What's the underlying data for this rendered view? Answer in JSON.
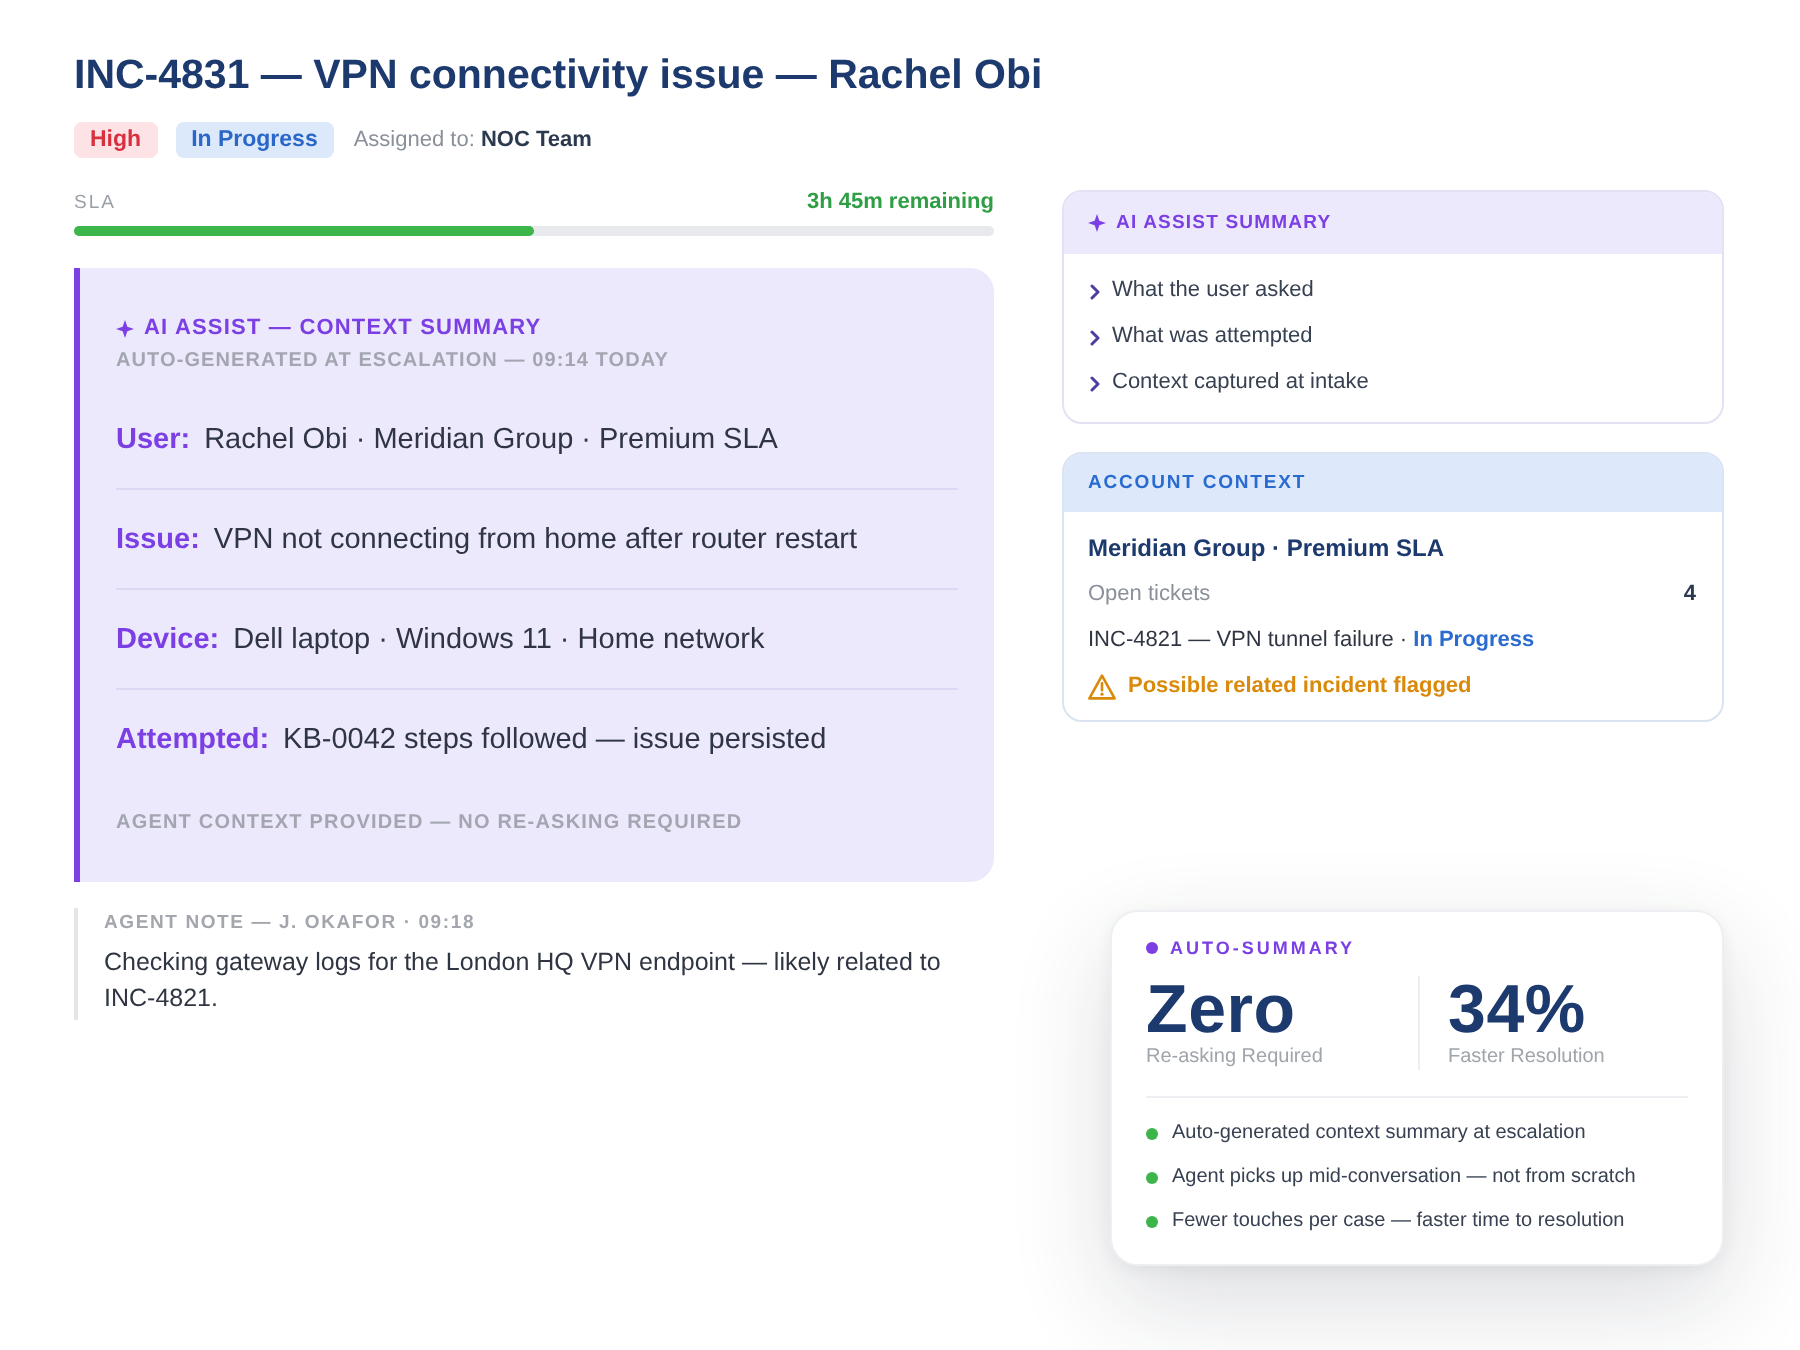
{
  "ticket": {
    "title": "INC-4831 — VPN connectivity issue — Rachel Obi",
    "badges": [
      {
        "kind": "priority",
        "text": "High"
      },
      {
        "kind": "status",
        "text": "In Progress"
      }
    ],
    "assigned": "Assigned to: **NOC Team**"
  },
  "sla": {
    "label": "SLA",
    "remaining": "3h 45m remaining",
    "level": 0.5
  },
  "context_summary": {
    "title": "AI ASSIST — CONTEXT SUMMARY",
    "subtitle": "AUTO-GENERATED AT ESCALATION — 09:14 TODAY",
    "fields": [
      {
        "label": "User:",
        "value": "Rachel Obi · Meridian Group · Premium SLA"
      },
      {
        "label": "Issue:",
        "value": "VPN not connecting from home after router restart"
      },
      {
        "label": "Device:",
        "value": "Dell laptop · Windows 11 · Home network"
      },
      {
        "label": "Attempted:",
        "value": "KB-0042 steps followed — issue persisted"
      }
    ],
    "footer": "AGENT CONTEXT PROVIDED — NO RE-ASKING REQUIRED"
  },
  "agent_note": {
    "header": "AGENT NOTE — J. OKAFOR · 09:18",
    "text": "Checking gateway logs for the London HQ VPN endpoint — likely related to INC-4821."
  },
  "assist_summary": {
    "title": "AI ASSIST SUMMARY",
    "items": [
      "What the user asked",
      "What was attempted",
      "Context captured at intake"
    ]
  },
  "account_context": {
    "title": "ACCOUNT CONTEXT",
    "account": "Meridian Group · Premium SLA",
    "open_tickets": {
      "label": "Open tickets",
      "value": "4"
    },
    "related": "INC-4821 — VPN tunnel failure · **In Progress**",
    "warning": "Possible related incident flagged"
  },
  "auto_summary": {
    "label": "AUTO-SUMMARY",
    "stats": [
      {
        "value": "Zero",
        "caption": "Re-asking Required"
      },
      {
        "value": "34%",
        "caption": "Faster Resolution"
      }
    ],
    "points": [
      "Auto-generated context summary at escalation",
      "Agent picks up mid-conversation — not from scratch",
      "Fewer touches per case — faster time to resolution"
    ]
  }
}
